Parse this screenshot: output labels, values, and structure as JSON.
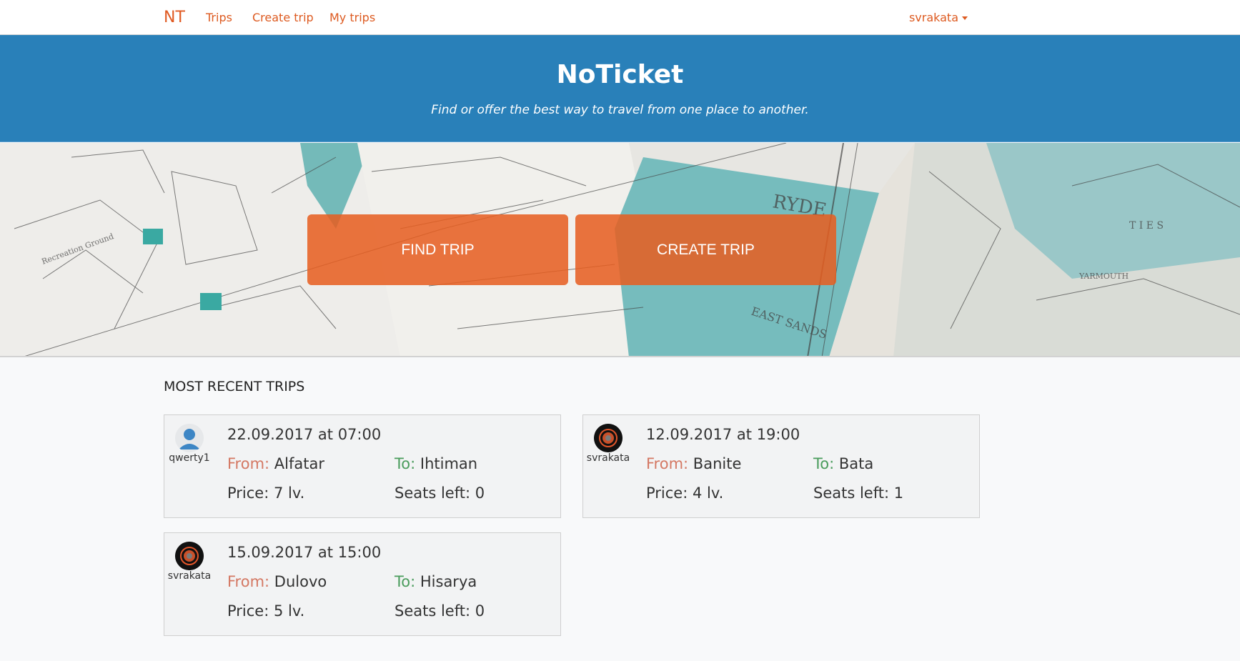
{
  "nav": {
    "brand": "NT",
    "links": [
      "Trips",
      "Create trip",
      "My trips"
    ],
    "user": "svrakata"
  },
  "jumbotron": {
    "title": "NoTicket",
    "subtitle": "Find or offer the best way to travel from one place to another."
  },
  "hero": {
    "find_label": "FIND TRIP",
    "create_label": "CREATE TRIP"
  },
  "recent": {
    "title": "MOST RECENT TRIPS",
    "from_label": "From:",
    "to_label": "To:",
    "trips": [
      {
        "user": "qwerty1",
        "avatar": "default-user-icon",
        "date": "22.09.2017 at 07:00",
        "from": "Alfatar",
        "to": "Ihtiman",
        "price": "Price: 7 lv.",
        "seats": "Seats left: 0"
      },
      {
        "user": "svrakata",
        "avatar": "svrakata-avatar",
        "date": "12.09.2017 at 19:00",
        "from": "Banite",
        "to": "Bata",
        "price": "Price: 4 lv.",
        "seats": "Seats left: 1"
      },
      {
        "user": "svrakata",
        "avatar": "svrakata-avatar",
        "date": "15.09.2017 at 15:00",
        "from": "Dulovo",
        "to": "Hisarya",
        "price": "Price: 5 lv.",
        "seats": "Seats left: 0"
      }
    ]
  },
  "colors": {
    "accent": "#e05a22",
    "jumbo": "#2980b9",
    "hero_button": "#e65d20",
    "from_label": "#d47863",
    "to_label": "#4a9c5c"
  }
}
